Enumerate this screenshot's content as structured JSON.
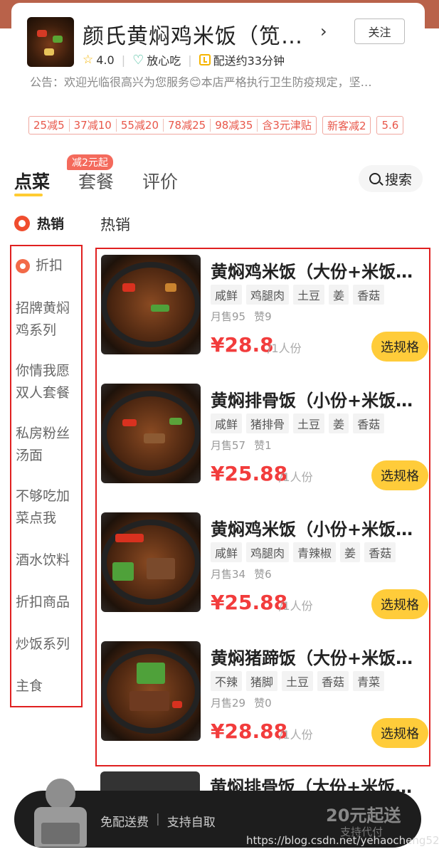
{
  "store": {
    "name": "颜氏黄焖鸡米饭（笕…",
    "follow_label": "关注",
    "rating": "4.0",
    "safe_label": "放心吃",
    "delivery": "配送约33分钟",
    "notice": "公告：欢迎光临很高兴为您服务😊本店严格执行卫生防疫规定，坚…"
  },
  "coupons": {
    "full_reduction": [
      "25减5",
      "37减10",
      "55减20",
      "78减25",
      "98减35",
      "含3元津贴"
    ],
    "others": [
      "新客减2",
      "5.6"
    ]
  },
  "tabs": [
    {
      "label": "点菜",
      "active": true
    },
    {
      "label": "套餐",
      "active": false
    },
    {
      "label": "评价",
      "active": false
    }
  ],
  "tab_badge": "减2元起",
  "search_label": "搜索",
  "hot": {
    "sidebar_label": "热销",
    "section_title": "热销"
  },
  "categories": [
    "折扣",
    "招牌黄焖鸡系列",
    "你情我愿双人套餐",
    "私房粉丝汤面",
    "不够吃加菜点我",
    "酒水饮料",
    "折扣商品",
    "炒饭系列",
    "主食"
  ],
  "items": [
    {
      "name": "黄焖鸡米饭（大份+米饭…",
      "tags": [
        "咸鲜",
        "鸡腿肉",
        "土豆",
        "姜",
        "香菇"
      ],
      "sales": "月售95",
      "likes": "赞9",
      "price": "¥28.8",
      "unit": "/1人份",
      "button": "选规格"
    },
    {
      "name": "黄焖排骨饭（小份+米饭…",
      "tags": [
        "咸鲜",
        "猪排骨",
        "土豆",
        "姜",
        "香菇"
      ],
      "sales": "月售57",
      "likes": "赞1",
      "price": "¥25.88",
      "unit": "/1人份",
      "button": "选规格"
    },
    {
      "name": "黄焖鸡米饭（小份+米饭…",
      "tags": [
        "咸鲜",
        "鸡腿肉",
        "青辣椒",
        "姜",
        "香菇"
      ],
      "sales": "月售34",
      "likes": "赞6",
      "price": "¥25.88",
      "unit": "/1人份",
      "button": "选规格"
    },
    {
      "name": "黄焖猪蹄饭（大份+米饭…",
      "tags": [
        "不辣",
        "猪脚",
        "土豆",
        "香菇",
        "青菜"
      ],
      "sales": "月售29",
      "likes": "赞0",
      "price": "¥28.88",
      "unit": "/1人份",
      "button": "选规格"
    }
  ],
  "peek_item_name": "黄焖排骨饭（大份+米饭…",
  "cart": {
    "free_delivery": "免配送费",
    "self_pickup": "支持自取",
    "min_order": "20元起送",
    "peer_pay": "支持代付"
  },
  "watermark": "https://blog.csdn.net/yehaocheng520"
}
